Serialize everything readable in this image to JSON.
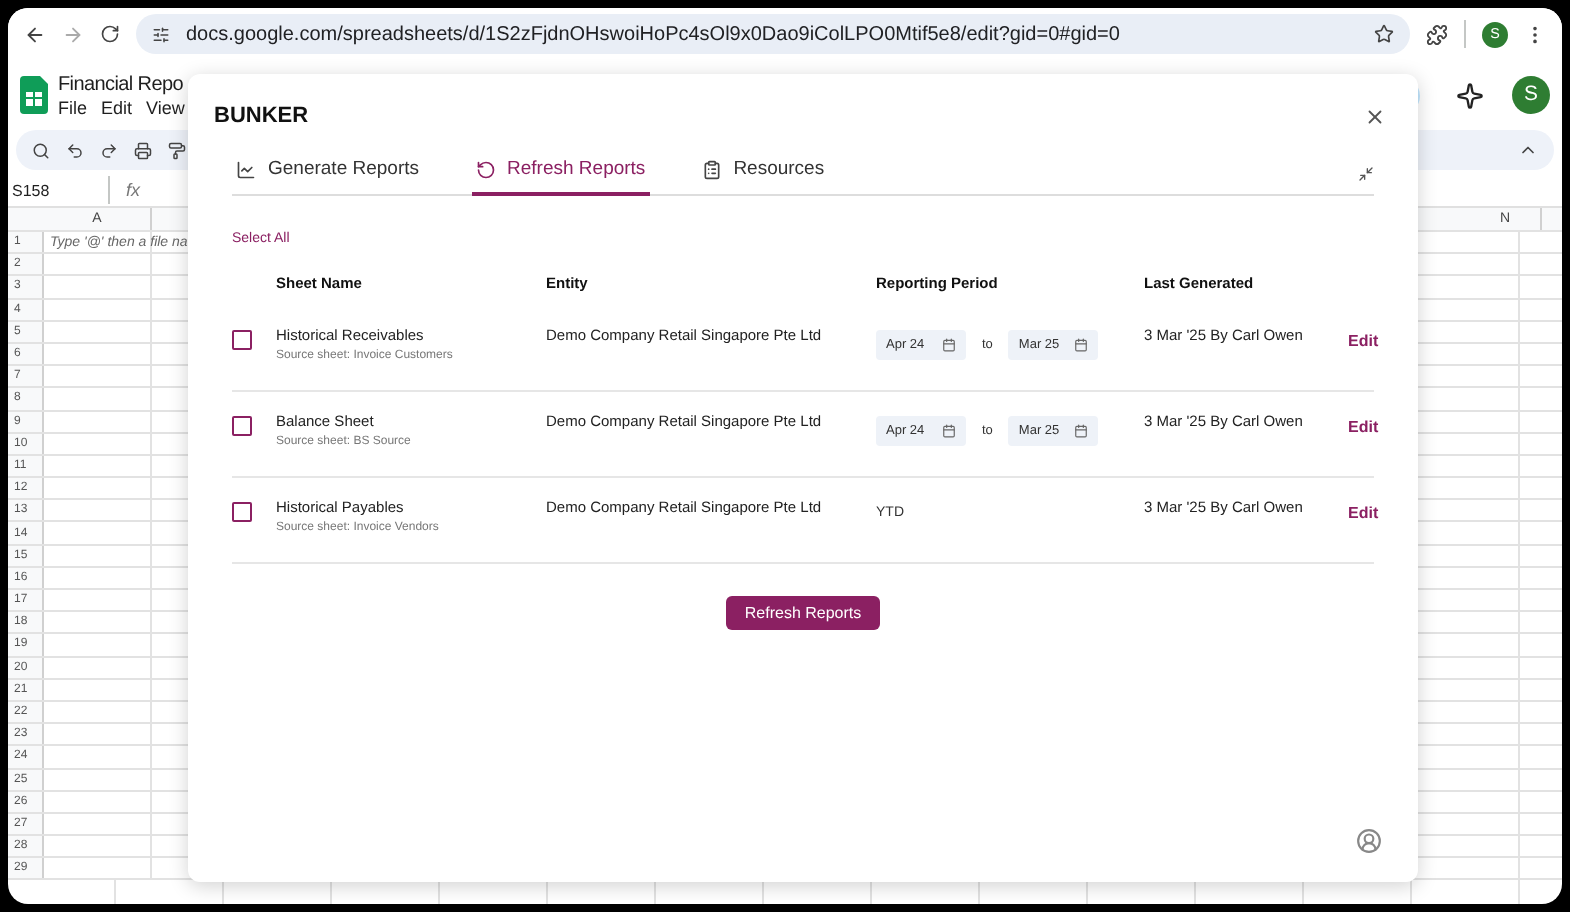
{
  "browser": {
    "url": "docs.google.com/spreadsheets/d/1S2zFjdnOHswoiHoPc4sOl9x0Dao9iColLPO0Mtif5e8/edit?gid=0#gid=0",
    "profile_letter": "S"
  },
  "sheets": {
    "title": "Financial Repo",
    "menus": [
      "File",
      "Edit",
      "View"
    ],
    "profile_letter": "S",
    "name_box": "S158",
    "formula_label": "fx",
    "columns": [
      "A",
      "N"
    ],
    "row_numbers": [
      "1",
      "2",
      "3",
      "4",
      "5",
      "6",
      "7",
      "8",
      "9",
      "10",
      "11",
      "12",
      "13",
      "14",
      "15",
      "16",
      "17",
      "18",
      "19",
      "20",
      "21",
      "22",
      "23",
      "24",
      "25",
      "26",
      "27",
      "28",
      "29"
    ],
    "cell_a1": "Type '@' then a file na"
  },
  "dialog": {
    "title": "BUNKER",
    "tabs": [
      {
        "label": "Generate Reports",
        "kind": "chart",
        "selected": false
      },
      {
        "label": "Refresh Reports",
        "kind": "refresh",
        "selected": true
      },
      {
        "label": "Resources",
        "kind": "clipboard",
        "selected": false
      }
    ],
    "select_all": "Select All",
    "columns": [
      "Sheet Name",
      "Entity",
      "Reporting Period",
      "Last Generated"
    ],
    "rows": [
      {
        "checked": false,
        "sheet": "Historical Receivables",
        "source": "Source sheet: Invoice Customers",
        "entity": "Demo Company Retail Singapore Pte Ltd",
        "period": {
          "kind": "range",
          "from": "Apr 24",
          "separator": "to",
          "to": "Mar 25"
        },
        "last_generated": "3 Mar '25 By Carl Owen",
        "action": "Edit"
      },
      {
        "checked": false,
        "sheet": "Balance Sheet",
        "source": "Source sheet: BS Source",
        "entity": "Demo Company Retail Singapore Pte Ltd",
        "period": {
          "kind": "range",
          "from": "Apr 24",
          "separator": "to",
          "to": "Mar 25"
        },
        "last_generated": "3 Mar '25 By Carl Owen",
        "action": "Edit"
      },
      {
        "checked": false,
        "sheet": "Historical Payables",
        "source": "Source sheet: Invoice Vendors",
        "entity": "Demo Company Retail Singapore Pte Ltd",
        "period": {
          "kind": "text",
          "text": "YTD"
        },
        "last_generated": "3 Mar '25 By Carl Owen",
        "action": "Edit"
      }
    ],
    "button": "Refresh Reports"
  }
}
